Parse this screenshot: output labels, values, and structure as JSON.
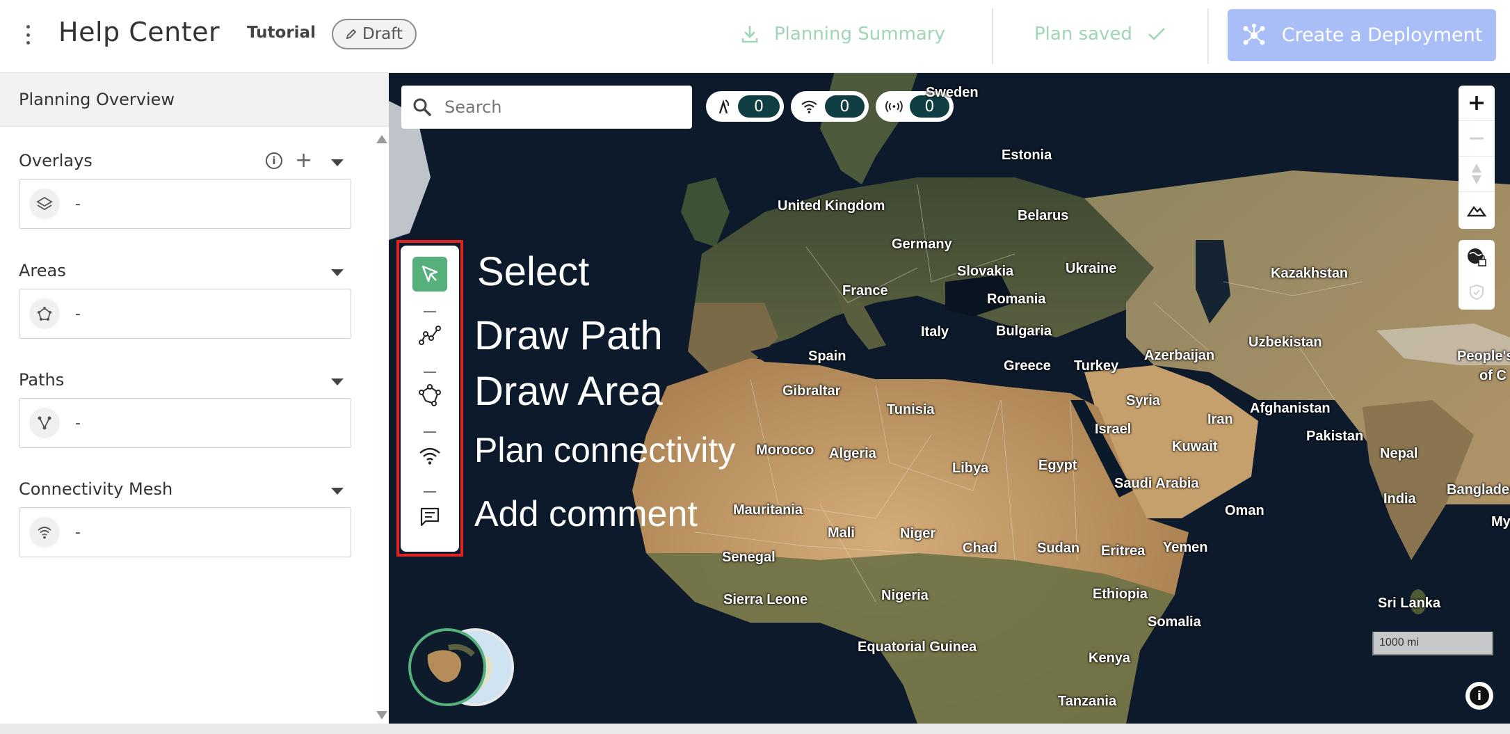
{
  "header": {
    "title": "Help Center",
    "tutorial_label": "Tutorial",
    "draft_label": "Draft",
    "planning_summary_label": "Planning Summary",
    "plan_saved_label": "Plan saved",
    "create_deployment_label": "Create a Deployment"
  },
  "sidebar": {
    "title": "Planning Overview",
    "sections": [
      {
        "label": "Overlays",
        "value": "-"
      },
      {
        "label": "Areas",
        "value": "-"
      },
      {
        "label": "Paths",
        "value": "-"
      },
      {
        "label": "Connectivity Mesh",
        "value": "-"
      }
    ]
  },
  "map": {
    "search_placeholder": "Search",
    "counters": [
      {
        "icon": "tower-icon",
        "value": "0"
      },
      {
        "icon": "wifi-icon",
        "value": "0"
      },
      {
        "icon": "signal-icon",
        "value": "0"
      }
    ],
    "tools": [
      {
        "label": "Select",
        "icon": "cursor-icon",
        "active": true
      },
      {
        "label": "Draw Path",
        "icon": "path-icon",
        "active": false
      },
      {
        "label": "Draw Area",
        "icon": "area-icon",
        "active": false
      },
      {
        "label": "Plan connectivity",
        "icon": "wifi-icon",
        "active": false
      },
      {
        "label": "Add comment",
        "icon": "comment-icon",
        "active": false
      }
    ],
    "scale_label": "1000 mi",
    "countries": [
      "Sweden",
      "Estonia",
      "United Kingdom",
      "Belarus",
      "Germany",
      "Slovakia",
      "Ukraine",
      "Kazakhstan",
      "France",
      "Romania",
      "Italy",
      "Bulgaria",
      "Uzbekistan",
      "People's",
      "of C",
      "Spain",
      "Greece",
      "Turkey",
      "Azerbaijan",
      "Gibraltar",
      "Syria",
      "Tunisia",
      "Afghanistan",
      "Iran",
      "Israel",
      "Pakistan",
      "Morocco",
      "Algeria",
      "Kuwait",
      "Nepal",
      "Libya",
      "Egypt",
      "Saudi Arabia",
      "India",
      "Banglades",
      "Mauritania",
      "Oman",
      "My",
      "Mali",
      "Niger",
      "Chad",
      "Sudan",
      "Eritrea",
      "Yemen",
      "Senegal",
      "Ethiopia",
      "Sierra Leone",
      "Nigeria",
      "Sri Lanka",
      "Somalia",
      "Equatorial Guinea",
      "Kenya",
      "Tanzania"
    ],
    "colors": {
      "ocean": "#0c1a2c",
      "land": "#b68c5a",
      "accent": "#55b07c",
      "highlight": "#e02424"
    }
  }
}
